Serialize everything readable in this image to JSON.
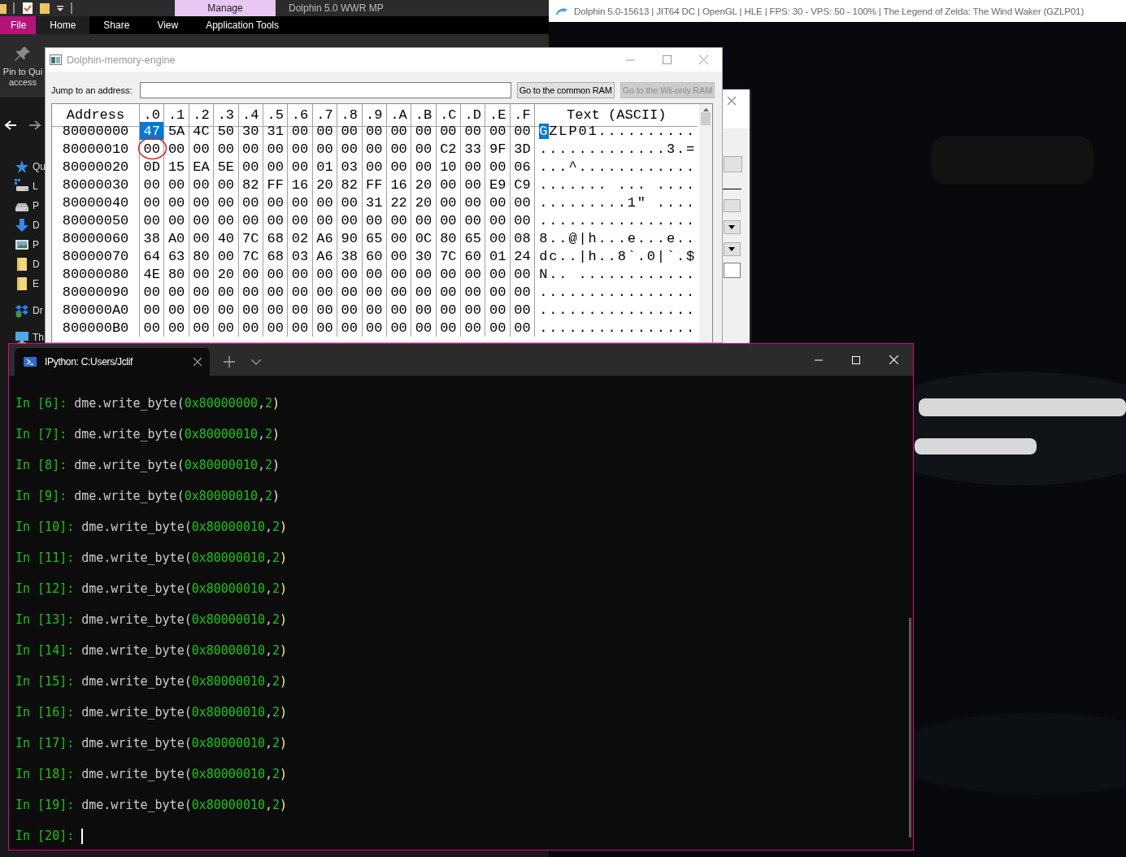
{
  "explorer": {
    "context_tab": "Manage",
    "title": "Dolphin 5.0 WWR MP",
    "ribbon_tabs": [
      {
        "label": "File",
        "kind": "file",
        "selected": false
      },
      {
        "label": "Home",
        "kind": "tab",
        "selected": true
      },
      {
        "label": "Share",
        "kind": "tab",
        "selected": false
      },
      {
        "label": "View",
        "kind": "tab",
        "selected": false
      },
      {
        "label": "Application Tools",
        "kind": "tab",
        "selected": false
      }
    ],
    "pin_label": [
      "Pin to Qui",
      "access"
    ],
    "nav_items": [
      {
        "label": "Qu",
        "kind": "star"
      },
      {
        "label": "L",
        "kind": "netdrive"
      },
      {
        "label": "P",
        "kind": "drive"
      },
      {
        "label": "D",
        "kind": "download"
      },
      {
        "label": "P",
        "kind": "picture"
      },
      {
        "label": "D",
        "kind": "folder"
      },
      {
        "label": "E",
        "kind": "folder"
      },
      {
        "label": "Dr",
        "kind": "cloud"
      },
      {
        "label": "Th",
        "kind": "monitor"
      }
    ]
  },
  "game_window": {
    "title": "Dolphin 5.0-15613 | JIT64 DC | OpenGL | HLE | FPS: 30 - VPS: 50 - 100% | The Legend of Zelda: The Wind Waker (GZLP01)"
  },
  "memory_engine": {
    "title": "Dolphin-memory-engine",
    "jump_label": "Jump to an address:",
    "buttons": [
      {
        "label": "Go to the common RAM",
        "disabled": false
      },
      {
        "label": "Go to the Wii-only RAM",
        "disabled": true
      }
    ],
    "hex_view": {
      "columns": [
        "Address",
        ".0",
        ".1",
        ".2",
        ".3",
        ".4",
        ".5",
        ".6",
        ".7",
        ".8",
        ".9",
        ".A",
        ".B",
        ".C",
        ".D",
        ".E",
        ".F",
        "Text (ASCII)"
      ],
      "rows": [
        {
          "address": "80000000",
          "bytes": [
            "47",
            "5A",
            "4C",
            "50",
            "30",
            "31",
            "00",
            "00",
            "00",
            "00",
            "00",
            "00",
            "00",
            "00",
            "00",
            "00"
          ],
          "text": "GZLP01..........",
          "selected": true,
          "circled": false
        },
        {
          "address": "80000010",
          "bytes": [
            "00",
            "00",
            "00",
            "00",
            "00",
            "00",
            "00",
            "00",
            "00",
            "00",
            "00",
            "00",
            "C2",
            "33",
            "9F",
            "3D"
          ],
          "text": ".............3.=",
          "selected": false,
          "circled": true
        },
        {
          "address": "80000020",
          "bytes": [
            "0D",
            "15",
            "EA",
            "5E",
            "00",
            "00",
            "00",
            "01",
            "03",
            "00",
            "00",
            "00",
            "10",
            "00",
            "00",
            "06"
          ],
          "text": "...^............",
          "selected": false,
          "circled": false
        },
        {
          "address": "80000030",
          "bytes": [
            "00",
            "00",
            "00",
            "00",
            "82",
            "FF",
            "16",
            "20",
            "82",
            "FF",
            "16",
            "20",
            "00",
            "00",
            "E9",
            "C9"
          ],
          "text": "....... ... ....",
          "selected": false,
          "circled": false
        },
        {
          "address": "80000040",
          "bytes": [
            "00",
            "00",
            "00",
            "00",
            "00",
            "00",
            "00",
            "00",
            "00",
            "31",
            "22",
            "20",
            "00",
            "00",
            "00",
            "00"
          ],
          "text": ".........1\" ....",
          "selected": false,
          "circled": false
        },
        {
          "address": "80000050",
          "bytes": [
            "00",
            "00",
            "00",
            "00",
            "00",
            "00",
            "00",
            "00",
            "00",
            "00",
            "00",
            "00",
            "00",
            "00",
            "00",
            "00"
          ],
          "text": "................",
          "selected": false,
          "circled": false
        },
        {
          "address": "80000060",
          "bytes": [
            "38",
            "A0",
            "00",
            "40",
            "7C",
            "68",
            "02",
            "A6",
            "90",
            "65",
            "00",
            "0C",
            "80",
            "65",
            "00",
            "08"
          ],
          "text": "8..@|h...e...e..",
          "selected": false,
          "circled": false
        },
        {
          "address": "80000070",
          "bytes": [
            "64",
            "63",
            "80",
            "00",
            "7C",
            "68",
            "03",
            "A6",
            "38",
            "60",
            "00",
            "30",
            "7C",
            "60",
            "01",
            "24"
          ],
          "text": "dc..|h..8`.0|`.$",
          "selected": false,
          "circled": false
        },
        {
          "address": "80000080",
          "bytes": [
            "4E",
            "80",
            "00",
            "20",
            "00",
            "00",
            "00",
            "00",
            "00",
            "00",
            "00",
            "00",
            "00",
            "00",
            "00",
            "00"
          ],
          "text": "N.. ............",
          "selected": false,
          "circled": false
        },
        {
          "address": "80000090",
          "bytes": [
            "00",
            "00",
            "00",
            "00",
            "00",
            "00",
            "00",
            "00",
            "00",
            "00",
            "00",
            "00",
            "00",
            "00",
            "00",
            "00"
          ],
          "text": "................",
          "selected": false,
          "circled": false
        },
        {
          "address": "800000A0",
          "bytes": [
            "00",
            "00",
            "00",
            "00",
            "00",
            "00",
            "00",
            "00",
            "00",
            "00",
            "00",
            "00",
            "00",
            "00",
            "00",
            "00"
          ],
          "text": "................",
          "selected": false,
          "circled": false
        },
        {
          "address": "800000B0",
          "bytes": [
            "00",
            "00",
            "00",
            "00",
            "00",
            "00",
            "00",
            "00",
            "00",
            "00",
            "00",
            "00",
            "00",
            "00",
            "00",
            "00"
          ],
          "text": "................",
          "selected": false,
          "circled": false
        }
      ]
    }
  },
  "terminal": {
    "tab": {
      "title": "IPython: C:Users/Jclif"
    },
    "lines": [
      {
        "prompt": "In [6]:",
        "tokens": [
          {
            "kind": "name",
            "text": "dme.write_byte("
          },
          {
            "kind": "number",
            "text": "0x80000000"
          },
          {
            "kind": "punct",
            "text": ","
          },
          {
            "kind": "number",
            "text": "2"
          },
          {
            "kind": "paren",
            "text": ")"
          }
        ],
        "cursor": false
      },
      {
        "prompt": "In [7]:",
        "tokens": [
          {
            "kind": "name",
            "text": "dme.write_byte("
          },
          {
            "kind": "number",
            "text": "0x80000010"
          },
          {
            "kind": "punct",
            "text": ","
          },
          {
            "kind": "number",
            "text": "2"
          },
          {
            "kind": "paren",
            "text": ")"
          }
        ],
        "cursor": false
      },
      {
        "prompt": "In [8]:",
        "tokens": [
          {
            "kind": "name",
            "text": "dme.write_byte("
          },
          {
            "kind": "number",
            "text": "0x80000010"
          },
          {
            "kind": "punct",
            "text": ","
          },
          {
            "kind": "number",
            "text": "2"
          },
          {
            "kind": "paren",
            "text": ")"
          }
        ],
        "cursor": false
      },
      {
        "prompt": "In [9]:",
        "tokens": [
          {
            "kind": "name",
            "text": "dme.write_byte("
          },
          {
            "kind": "number",
            "text": "0x80000010"
          },
          {
            "kind": "punct",
            "text": ","
          },
          {
            "kind": "number",
            "text": "2"
          },
          {
            "kind": "paren",
            "text": ")"
          }
        ],
        "cursor": false
      },
      {
        "prompt": "In [10]:",
        "tokens": [
          {
            "kind": "name",
            "text": "dme.write_byte("
          },
          {
            "kind": "number",
            "text": "0x80000010"
          },
          {
            "kind": "punct",
            "text": ","
          },
          {
            "kind": "number",
            "text": "2"
          },
          {
            "kind": "paren",
            "text": ")"
          }
        ],
        "cursor": false
      },
      {
        "prompt": "In [11]:",
        "tokens": [
          {
            "kind": "name",
            "text": "dme.write_byte("
          },
          {
            "kind": "number",
            "text": "0x80000010"
          },
          {
            "kind": "punct",
            "text": ","
          },
          {
            "kind": "number",
            "text": "2"
          },
          {
            "kind": "paren",
            "text": ")"
          }
        ],
        "cursor": false
      },
      {
        "prompt": "In [12]:",
        "tokens": [
          {
            "kind": "name",
            "text": "dme.write_byte("
          },
          {
            "kind": "number",
            "text": "0x80000010"
          },
          {
            "kind": "punct",
            "text": ","
          },
          {
            "kind": "number",
            "text": "2"
          },
          {
            "kind": "paren",
            "text": ")"
          }
        ],
        "cursor": false
      },
      {
        "prompt": "In [13]:",
        "tokens": [
          {
            "kind": "name",
            "text": "dme.write_byte("
          },
          {
            "kind": "number",
            "text": "0x80000010"
          },
          {
            "kind": "punct",
            "text": ","
          },
          {
            "kind": "number",
            "text": "2"
          },
          {
            "kind": "paren",
            "text": ")"
          }
        ],
        "cursor": false
      },
      {
        "prompt": "In [14]:",
        "tokens": [
          {
            "kind": "name",
            "text": "dme.write_byte("
          },
          {
            "kind": "number",
            "text": "0x80000010"
          },
          {
            "kind": "punct",
            "text": ","
          },
          {
            "kind": "number",
            "text": "2"
          },
          {
            "kind": "paren",
            "text": ")"
          }
        ],
        "cursor": false
      },
      {
        "prompt": "In [15]:",
        "tokens": [
          {
            "kind": "name",
            "text": "dme.write_byte("
          },
          {
            "kind": "number",
            "text": "0x80000010"
          },
          {
            "kind": "punct",
            "text": ","
          },
          {
            "kind": "number",
            "text": "2"
          },
          {
            "kind": "paren",
            "text": ")"
          }
        ],
        "cursor": false
      },
      {
        "prompt": "In [16]:",
        "tokens": [
          {
            "kind": "name",
            "text": "dme.write_byte("
          },
          {
            "kind": "number",
            "text": "0x80000010"
          },
          {
            "kind": "punct",
            "text": ","
          },
          {
            "kind": "number",
            "text": "2"
          },
          {
            "kind": "paren",
            "text": ")"
          }
        ],
        "cursor": false
      },
      {
        "prompt": "In [17]:",
        "tokens": [
          {
            "kind": "name",
            "text": "dme.write_byte("
          },
          {
            "kind": "number",
            "text": "0x80000010"
          },
          {
            "kind": "punct",
            "text": ","
          },
          {
            "kind": "number",
            "text": "2"
          },
          {
            "kind": "paren",
            "text": ")"
          }
        ],
        "cursor": false
      },
      {
        "prompt": "In [18]:",
        "tokens": [
          {
            "kind": "name",
            "text": "dme.write_byte("
          },
          {
            "kind": "number",
            "text": "0x80000010"
          },
          {
            "kind": "punct",
            "text": ","
          },
          {
            "kind": "number",
            "text": "2"
          },
          {
            "kind": "paren",
            "text": ")"
          }
        ],
        "cursor": false
      },
      {
        "prompt": "In [19]:",
        "tokens": [
          {
            "kind": "name",
            "text": "dme.write_byte("
          },
          {
            "kind": "number",
            "text": "0x80000010"
          },
          {
            "kind": "punct",
            "text": ","
          },
          {
            "kind": "number",
            "text": "2"
          },
          {
            "kind": "paren",
            "text": ")"
          }
        ],
        "cursor": false
      },
      {
        "prompt": "In [20]:",
        "cursor": true
      }
    ]
  }
}
